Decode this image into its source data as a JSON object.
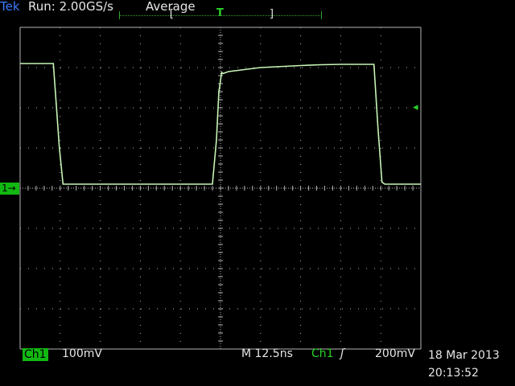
{
  "header": {
    "brand": "Tek",
    "status": "Run: 2.00GS/s",
    "mode": "Average",
    "trigger_position_marker": "T",
    "bracket_left": "[",
    "bracket_right": "]"
  },
  "channel_marker": "1",
  "trigger_level_marker": "◂",
  "footer": {
    "channel_label": "Ch1",
    "vertical_scale": "100mV",
    "timebase": "M 12.5ns",
    "trigger_channel": "Ch1",
    "trigger_slope_icon": "rising-edge-icon",
    "trigger_slope_glyph": "ʃ",
    "trigger_level": "200mV",
    "date": "18 Mar 2013",
    "time": "20:13:52"
  },
  "colors": {
    "background": "#000000",
    "trace": "#c6f5b6",
    "grid": "#b4b4b4",
    "accent_green": "#12b812",
    "brand_blue": "#3c7cff"
  },
  "chart_data": {
    "type": "line",
    "grid": {
      "divisions_x": 10,
      "divisions_y": 8
    },
    "axes": {
      "x": {
        "unit": "div",
        "range": [
          0,
          10
        ],
        "scale_per_div": "12.5ns"
      },
      "y": {
        "unit": "div",
        "range": [
          -4,
          4
        ],
        "scale_per_div": "100mV",
        "ground_div": 0
      }
    },
    "series": [
      {
        "x": [
          0.0,
          0.83,
          0.98,
          1.07,
          2.5,
          4.8,
          4.9,
          4.96,
          5.03,
          5.06,
          5.2,
          6.0,
          7.0,
          7.5,
          8.0,
          8.83,
          8.93,
          9.03,
          9.1,
          10.0
        ],
        "y": [
          3.1,
          3.1,
          1.0,
          0.1,
          0.1,
          0.1,
          1.2,
          2.4,
          2.88,
          2.85,
          2.9,
          3.0,
          3.05,
          3.07,
          3.08,
          3.08,
          1.5,
          0.15,
          0.1,
          0.1
        ]
      }
    ]
  }
}
